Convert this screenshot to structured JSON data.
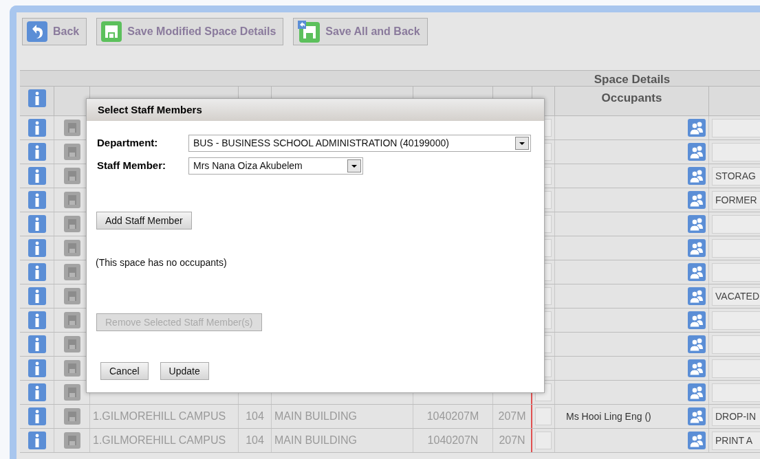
{
  "toolbar": [
    {
      "label": "Back",
      "kind": "back"
    },
    {
      "label": "Save Modified Space Details",
      "kind": "save"
    },
    {
      "label": "Save All and Back",
      "kind": "save_all"
    }
  ],
  "table": {
    "group_header": "Space Details",
    "occupants_header": "Occupants",
    "rows": [
      {},
      {},
      {
        "notes": "STORAG"
      },
      {
        "notes": "FORMER"
      },
      {},
      {},
      {},
      {
        "notes": "VACATED"
      },
      {},
      {},
      {},
      {},
      {
        "site": "1.GILMOREHILL CAMPUS",
        "bldg": "104",
        "building": "MAIN BUILDING",
        "room_code": "1040207M",
        "room": "207M",
        "occupants": "Ms Hooi Ling Eng ()",
        "notes": "DROP-IN"
      },
      {
        "site": "1.GILMOREHILL CAMPUS",
        "bldg": "104",
        "building": "MAIN BUILDING",
        "room_code": "1040207N",
        "room": "207N",
        "notes": "PRINT A"
      }
    ]
  },
  "dialog": {
    "title": "Select Staff Members",
    "fields": [
      {
        "label": "Department:",
        "value": "BUS - BUSINESS SCHOOL ADMINISTRATION (40199000)",
        "kind": "wide"
      },
      {
        "label": "Staff Member:",
        "value": "Mrs Nana Oiza Akubelem",
        "kind": "narrow"
      }
    ],
    "add_button": {
      "label": "Add Staff Member",
      "disabled": false
    },
    "message": "(This space has no occupants)",
    "remove_button": {
      "label": "Remove Selected Staff Member(s)",
      "disabled": true
    },
    "buttons": [
      "Cancel",
      "Update"
    ]
  }
}
